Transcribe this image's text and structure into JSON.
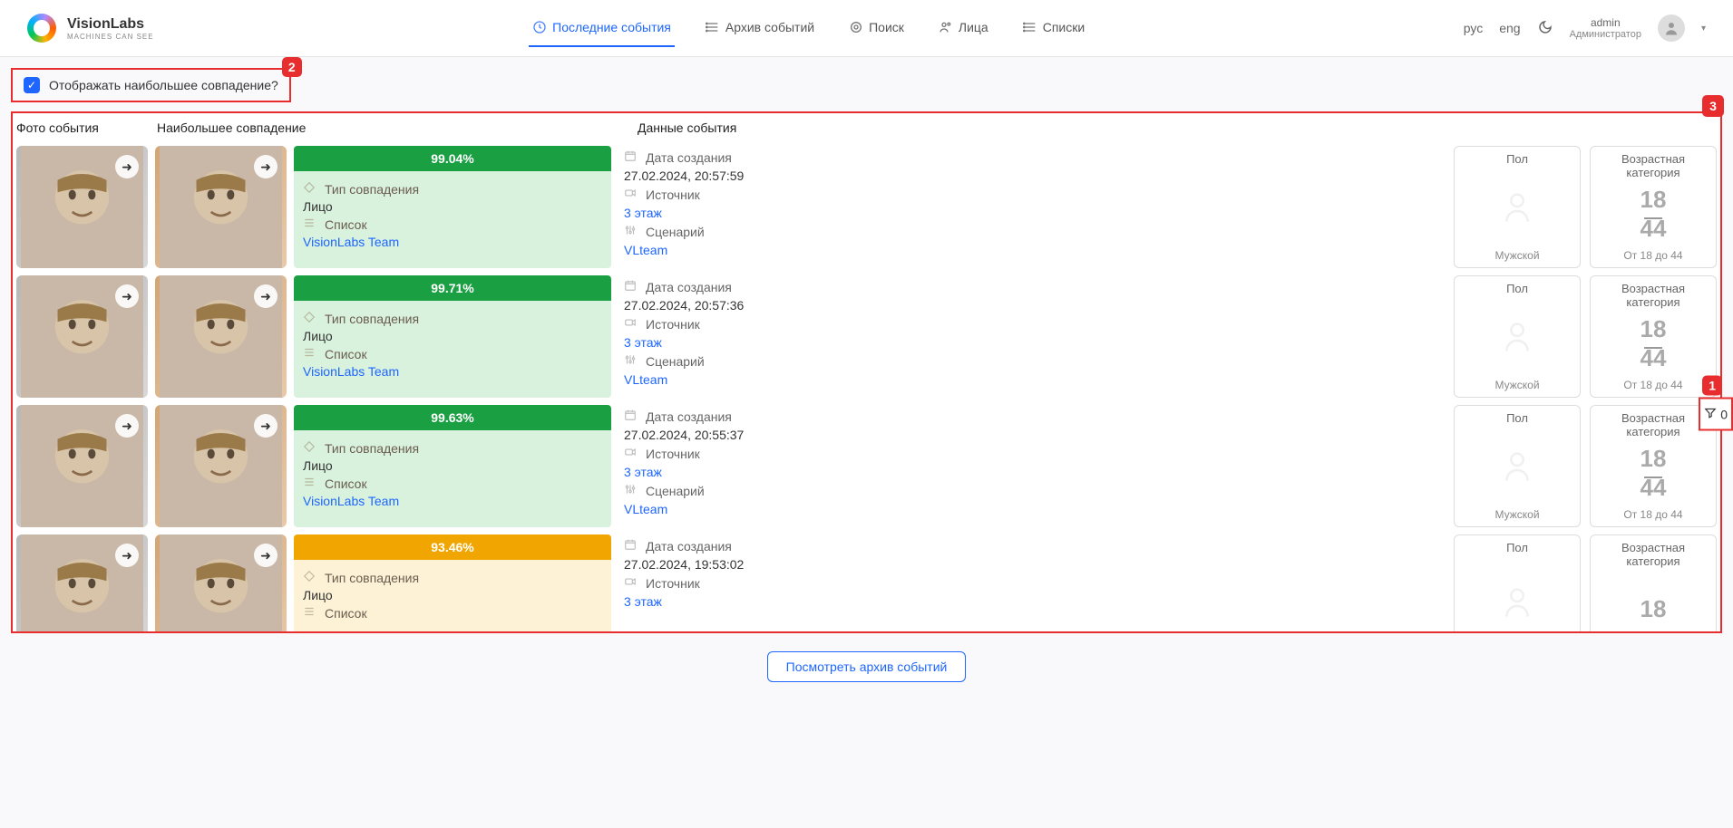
{
  "brand": {
    "name": "VisionLabs",
    "tagline": "MACHINES CAN SEE"
  },
  "nav": {
    "items": [
      {
        "label": "Последние события"
      },
      {
        "label": "Архив событий"
      },
      {
        "label": "Поиск"
      },
      {
        "label": "Лица"
      },
      {
        "label": "Списки"
      }
    ]
  },
  "lang": {
    "rus": "рус",
    "eng": "eng"
  },
  "user": {
    "name": "admin",
    "role": "Администратор"
  },
  "checkbox_label": "Отображать наибольшее совпадение?",
  "checkbox_checked": true,
  "badges": {
    "checkbox": "2",
    "main": "3",
    "filter": "1"
  },
  "columns": {
    "photo": "Фото события",
    "best_match": "Наибольшее совпадение",
    "event_data": "Данные события"
  },
  "labels": {
    "match_type": "Тип совпадения",
    "list": "Список",
    "created": "Дата создания",
    "source": "Источник",
    "scenario": "Сценарий",
    "gender": "Пол",
    "age_group": "Возрастная категория"
  },
  "events": [
    {
      "tone": "green",
      "pct": "99.04%",
      "match_type": "Лицо",
      "list": "VisionLabs Team",
      "created": "27.02.2024, 20:57:59",
      "source": "3 этаж",
      "scenario": "VLteam",
      "gender": "Мужской",
      "age_top": "18",
      "age_bot": "44",
      "age_range": "От 18 до 44"
    },
    {
      "tone": "green",
      "pct": "99.71%",
      "match_type": "Лицо",
      "list": "VisionLabs Team",
      "created": "27.02.2024, 20:57:36",
      "source": "3 этаж",
      "scenario": "VLteam",
      "gender": "Мужской",
      "age_top": "18",
      "age_bot": "44",
      "age_range": "От 18 до 44"
    },
    {
      "tone": "green",
      "pct": "99.63%",
      "match_type": "Лицо",
      "list": "VisionLabs Team",
      "created": "27.02.2024, 20:55:37",
      "source": "3 этаж",
      "scenario": "VLteam",
      "gender": "Мужской",
      "age_top": "18",
      "age_bot": "44",
      "age_range": "От 18 до 44"
    },
    {
      "tone": "orange",
      "pct": "93.46%",
      "match_type": "Лицо",
      "list": "",
      "created": "27.02.2024, 19:53:02",
      "source": "3 этаж",
      "scenario": "",
      "gender": "",
      "age_top": "18",
      "age_bot": "",
      "age_range": ""
    }
  ],
  "filter": {
    "count": "0"
  },
  "footer": {
    "archive_button": "Посмотреть архив событий"
  }
}
